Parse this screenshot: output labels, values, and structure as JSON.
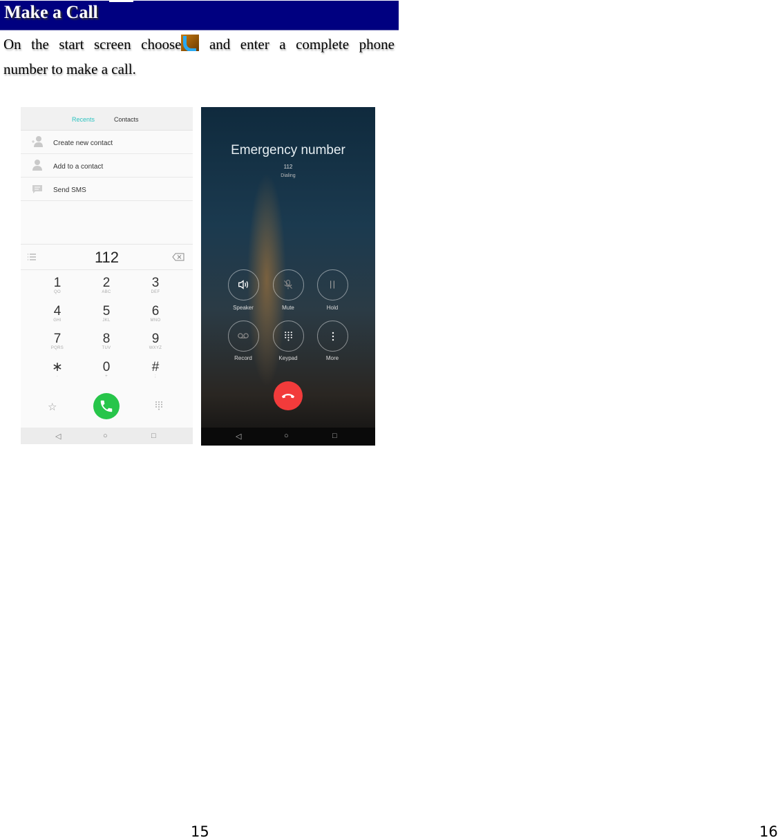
{
  "heading": "Make a Call",
  "paragraph": {
    "before_icon": [
      "On",
      "the",
      "start",
      "screen",
      "choose"
    ],
    "icon": "phone-app-icon",
    "after_icon": [
      "and",
      "enter",
      "a",
      "complete",
      "phone"
    ],
    "line2": "number to make a call."
  },
  "dialer": {
    "tabs": [
      {
        "label": "Recents",
        "active": true
      },
      {
        "label": "Contacts",
        "active": false
      }
    ],
    "options": [
      {
        "label": "Create new contact",
        "icon": "add-contact-icon"
      },
      {
        "label": "Add to a contact",
        "icon": "person-icon"
      },
      {
        "label": "Send SMS",
        "icon": "message-icon"
      }
    ],
    "number": "112",
    "keys": [
      {
        "digit": "1",
        "sub": "QO"
      },
      {
        "digit": "2",
        "sub": "ABC"
      },
      {
        "digit": "3",
        "sub": "DEF"
      },
      {
        "digit": "4",
        "sub": "GHI"
      },
      {
        "digit": "5",
        "sub": "JKL"
      },
      {
        "digit": "6",
        "sub": "MNO"
      },
      {
        "digit": "7",
        "sub": "PQRS"
      },
      {
        "digit": "8",
        "sub": "TUV"
      },
      {
        "digit": "9",
        "sub": "WXYZ"
      },
      {
        "digit": "∗",
        "sub": "·"
      },
      {
        "digit": "0",
        "sub": "+"
      },
      {
        "digit": "#",
        "sub": ";"
      }
    ],
    "call_color": "#27c54a",
    "accent_color": "#2cc3c0"
  },
  "in_call": {
    "title": "Emergency number",
    "number": "112",
    "status": "Dialing",
    "controls": [
      {
        "label": "Speaker",
        "icon": "speaker-icon"
      },
      {
        "label": "Mute",
        "icon": "mute-icon"
      },
      {
        "label": "Hold",
        "icon": "pause-icon"
      },
      {
        "label": "Record",
        "icon": "record-icon"
      },
      {
        "label": "Keypad",
        "icon": "keypad-icon"
      },
      {
        "label": "More",
        "icon": "more-icon"
      }
    ],
    "end_color": "#f23b3b"
  },
  "page_numbers": [
    "15",
    "16"
  ]
}
